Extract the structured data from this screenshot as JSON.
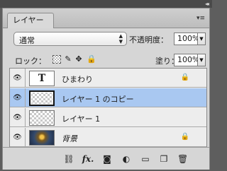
{
  "titlebar": {
    "collapse_glyph": "◂◂"
  },
  "tabs": [
    {
      "label": "レイヤー"
    }
  ],
  "panel_menu_glyph": "▾≡",
  "blend": {
    "mode": "通常",
    "opacity_label": "不透明度：",
    "opacity_value": "100%"
  },
  "lock": {
    "label": "ロック：",
    "fill_label": "塗り：",
    "fill_value": "100%"
  },
  "layers": [
    {
      "name": "ひまわり",
      "thumb": "T",
      "kind": "text",
      "locked": true,
      "visible": true,
      "selected": false
    },
    {
      "name": "レイヤー 1 のコピー",
      "kind": "pixel",
      "locked": false,
      "visible": true,
      "selected": true
    },
    {
      "name": "レイヤー 1",
      "kind": "pixel",
      "locked": false,
      "visible": true,
      "selected": false
    },
    {
      "name": "背景",
      "kind": "background",
      "locked": true,
      "visible": true,
      "selected": false
    }
  ],
  "footer_icons": [
    "link-icon",
    "fx-icon",
    "mask-icon",
    "adjustment-icon",
    "folder-icon",
    "new-layer-icon",
    "trash-icon"
  ],
  "glyphs": {
    "eye": "👁",
    "lock": "🔒",
    "dropdown": "▲▼",
    "drop_small": "▼",
    "fx": "fx.",
    "link": "⛓",
    "mask": "◙",
    "adjust": "◐",
    "folder": "▭",
    "newlayer": "❐",
    "trash": "🗑",
    "brush": "✎",
    "move": "✥"
  }
}
